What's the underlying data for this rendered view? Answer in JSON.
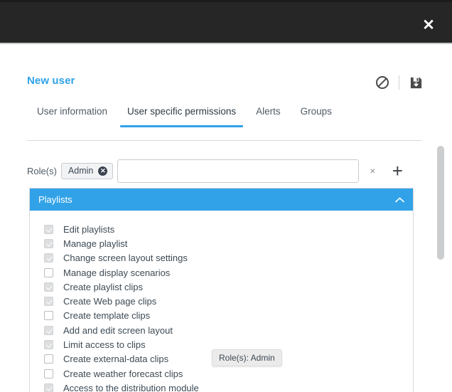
{
  "window": {
    "close_label": "✕"
  },
  "header": {
    "title": "New user",
    "actions": [
      {
        "name": "cancel-icon",
        "label": "Cancel"
      },
      {
        "name": "save-icon",
        "label": "Save"
      }
    ]
  },
  "tabs": [
    {
      "label": "User information",
      "active": false
    },
    {
      "label": "User specific permissions",
      "active": true
    },
    {
      "label": "Alerts",
      "active": false
    },
    {
      "label": "Groups",
      "active": false
    }
  ],
  "roles": {
    "label": "Role(s)",
    "chips": [
      {
        "label": "Admin",
        "remove_label": "✕"
      }
    ],
    "input_value": "",
    "input_placeholder": "",
    "clear_label": "×",
    "add_label": "+"
  },
  "permissions_panel": {
    "title": "Playlists",
    "collapse_icon": "⌃",
    "expanded": true,
    "items": [
      {
        "label": "Edit playlists",
        "checked": true
      },
      {
        "label": "Manage playlist",
        "checked": true
      },
      {
        "label": "Change screen layout settings",
        "checked": true
      },
      {
        "label": "Manage display scenarios",
        "checked": false
      },
      {
        "label": "Create playlist clips",
        "checked": true
      },
      {
        "label": "Create Web page clips",
        "checked": true
      },
      {
        "label": "Create template clips",
        "checked": false
      },
      {
        "label": "Add and edit screen layout",
        "checked": true
      },
      {
        "label": "Limit access to clips",
        "checked": true
      },
      {
        "label": "Create external-data clips",
        "checked": false
      },
      {
        "label": "Create weather forecast clips",
        "checked": false
      },
      {
        "label": "Access to the distribution module",
        "checked": true
      }
    ]
  },
  "tooltip": {
    "text": "Role(s): Admin"
  },
  "colors": {
    "accent": "#31a2e8",
    "topbar": "#262626",
    "text": "#3d4a54",
    "checkbox_checked": "#dcdedf",
    "scrollbar": "#cbcdcf",
    "tooltip_bg": "#ebebeb"
  }
}
